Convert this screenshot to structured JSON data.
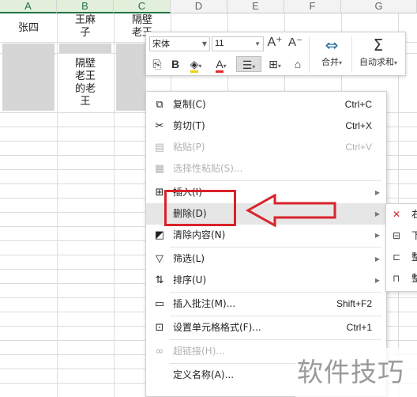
{
  "sheet": {
    "columns": [
      "A",
      "B",
      "C",
      "D",
      "E",
      "F",
      "G"
    ],
    "selected_columns": [
      "A",
      "B",
      "C"
    ],
    "cells": {
      "a1": "张四",
      "b1": "王麻子",
      "c1": "隔壁老王",
      "b3": "隔壁老王的老王"
    }
  },
  "mini_toolbar": {
    "font_name": "宋体",
    "font_size": "11",
    "grow_font": "A⁺",
    "shrink_font": "A⁻",
    "merge_label": "合并",
    "autosum_label": "自动求和",
    "bold": "B"
  },
  "context_menu": {
    "items": [
      {
        "label": "复制(C)",
        "shortcut": "Ctrl+C",
        "icon": "copy-icon",
        "enabled": true
      },
      {
        "label": "剪切(T)",
        "shortcut": "Ctrl+X",
        "icon": "cut-icon",
        "enabled": true
      },
      {
        "label": "粘贴(P)",
        "shortcut": "Ctrl+V",
        "icon": "paste-icon",
        "enabled": false
      },
      {
        "label": "选择性粘贴(S)...",
        "shortcut": "",
        "icon": "paste-special-icon",
        "enabled": false
      },
      {
        "label": "插入(I)",
        "shortcut": "",
        "icon": "insert-icon",
        "enabled": true
      },
      {
        "label": "删除(D)",
        "shortcut": "",
        "icon": "",
        "enabled": true
      },
      {
        "label": "清除内容(N)",
        "shortcut": "",
        "icon": "eraser-icon",
        "enabled": true
      },
      {
        "label": "筛选(L)",
        "shortcut": "",
        "icon": "filter-icon",
        "enabled": true
      },
      {
        "label": "排序(U)",
        "shortcut": "",
        "icon": "sort-icon",
        "enabled": true
      },
      {
        "label": "插入批注(M)...",
        "shortcut": "Shift+F2",
        "icon": "comment-icon",
        "enabled": true
      },
      {
        "label": "设置单元格格式(F)...",
        "shortcut": "Ctrl+1",
        "icon": "format-cells-icon",
        "enabled": true
      },
      {
        "label": "超链接(H)...",
        "shortcut": "",
        "icon": "link-icon",
        "enabled": false
      },
      {
        "label": "定义名称(A)...",
        "shortcut": "",
        "icon": "",
        "enabled": true
      }
    ]
  },
  "submenu": {
    "items": [
      {
        "text": "右"
      },
      {
        "text": "下"
      },
      {
        "text": "整"
      },
      {
        "text": "整"
      }
    ]
  },
  "annotation": {
    "color": "#d9232a"
  },
  "watermark": "软件技巧"
}
